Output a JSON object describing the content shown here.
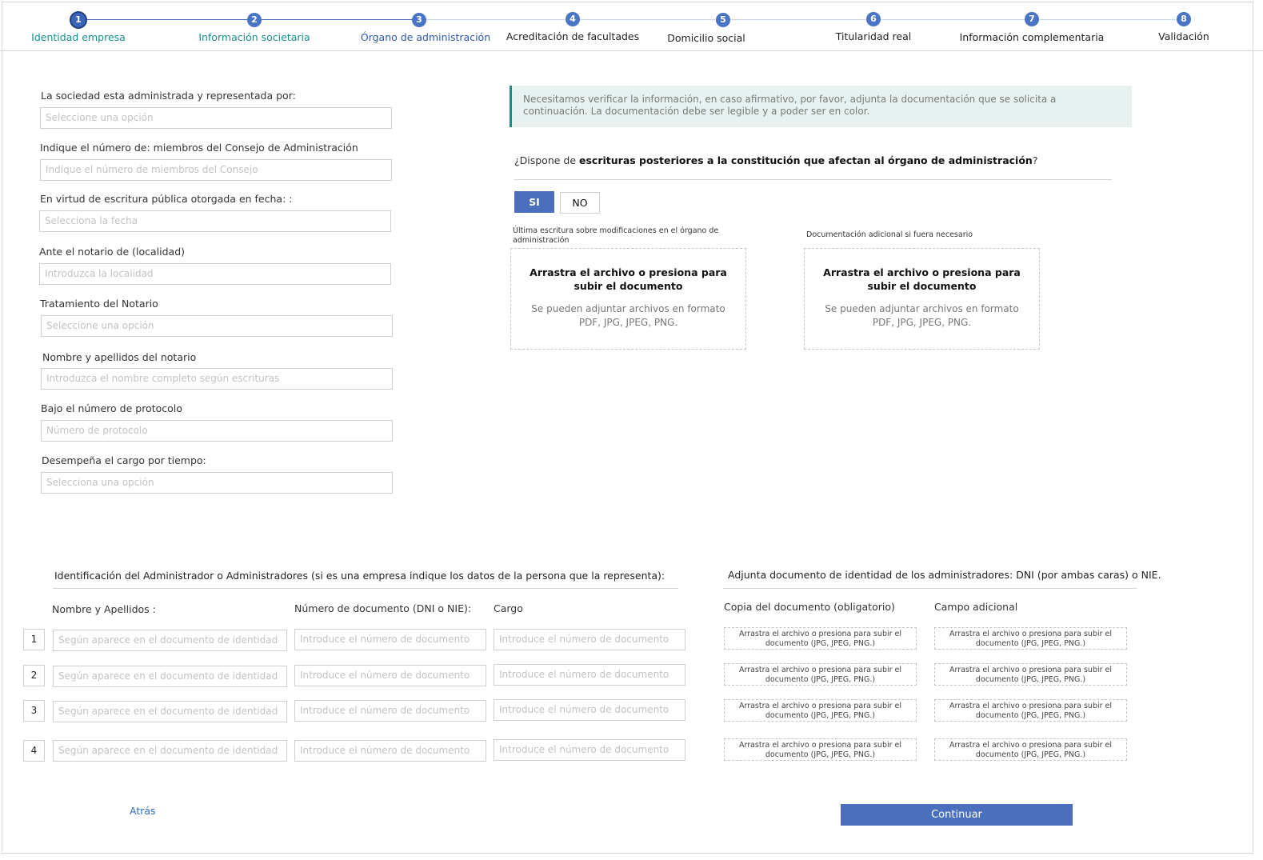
{
  "stepper": {
    "steps": [
      {
        "num": "1",
        "label": "Identidad empresa"
      },
      {
        "num": "2",
        "label": "Información societaria"
      },
      {
        "num": "3",
        "label": "Órgano de administración"
      },
      {
        "num": "4",
        "label": "Acreditación de facultades"
      },
      {
        "num": "5",
        "label": "Domicilio social"
      },
      {
        "num": "6",
        "label": "Titularidad real"
      },
      {
        "num": "7",
        "label": "Información complementaria"
      },
      {
        "num": "8",
        "label": "Validación"
      }
    ]
  },
  "form": {
    "fields": [
      {
        "label": "La sociedad esta administrada y representada por:",
        "placeholder": "Seleccione una opción"
      },
      {
        "label": "Indique el número de: miembros del Consejo de Administración",
        "placeholder": "Indique el número de miembros del Consejo"
      },
      {
        "label": "En virtud de escritura pública otorgada en fecha: :",
        "placeholder": "Selecciona la fecha"
      },
      {
        "label": "Ante el notario de (localidad)",
        "placeholder": "Introduzca la localidad"
      },
      {
        "label": "Tratamiento del Notario",
        "placeholder": "Seleccione una opción"
      },
      {
        "label": "Nombre y apellidos del notario",
        "placeholder": "Introduzca el nombre completo según escrituras"
      },
      {
        "label": "Bajo el número de protocolo",
        "placeholder": "Número de protocolo"
      },
      {
        "label": "Desempeña el cargo por tiempo:",
        "placeholder": "Selecciona una opción"
      }
    ]
  },
  "info": {
    "text": "Necesitamos verificar la información, en caso afirmativo, por favor, adjunta la documentación que se solicita a continuación. La documentación debe ser legible y a poder ser en color."
  },
  "question": {
    "prefix": "¿Dispone de ",
    "bold": "escrituras posteriores a la constitución que afectan al órgano de administración",
    "suffix": "?",
    "yes_label": "SI",
    "no_label": "NO"
  },
  "uploads": {
    "left_label": "Última escritura sobre modificaciones en el órgano de administración",
    "right_label": "Documentación adicional si fuera necesario",
    "drop_title": "Arrastra el archivo o presiona para subir el documento",
    "drop_hint": "Se pueden adjuntar archivos en formato PDF, JPG, JPEG, PNG."
  },
  "admins": {
    "title": "Identificación del Administrador o Administradores (si es una empresa indique los datos de la persona que la representa):",
    "col_name": "Nombre y Apellidos :",
    "col_doc": "Número de documento (DNI o NIE):",
    "col_cargo": "Cargo",
    "name_placeholder": "Según aparece en el documento de identidad",
    "doc_placeholder": "Introduce el número de documento",
    "cargo_placeholder": "Introduce el número de documento",
    "rows": [
      "1",
      "2",
      "3",
      "4"
    ]
  },
  "id_docs": {
    "title": "Adjunta documento de identidad de los administradores: DNI (por ambas caras) o NIE.",
    "col_copy": "Copia del documento (obligatorio)",
    "col_extra": "Campo adicional",
    "drop_text": "Arrastra el archivo o presiona para subir el documento (JPG, JPEG, PNG.)"
  },
  "footer": {
    "back_label": "Atrás",
    "continue_label": "Continuar"
  },
  "colors": {
    "primary": "#4a6fbd",
    "teal": "#1a8d8d",
    "info_bg": "#e6f1f0"
  }
}
